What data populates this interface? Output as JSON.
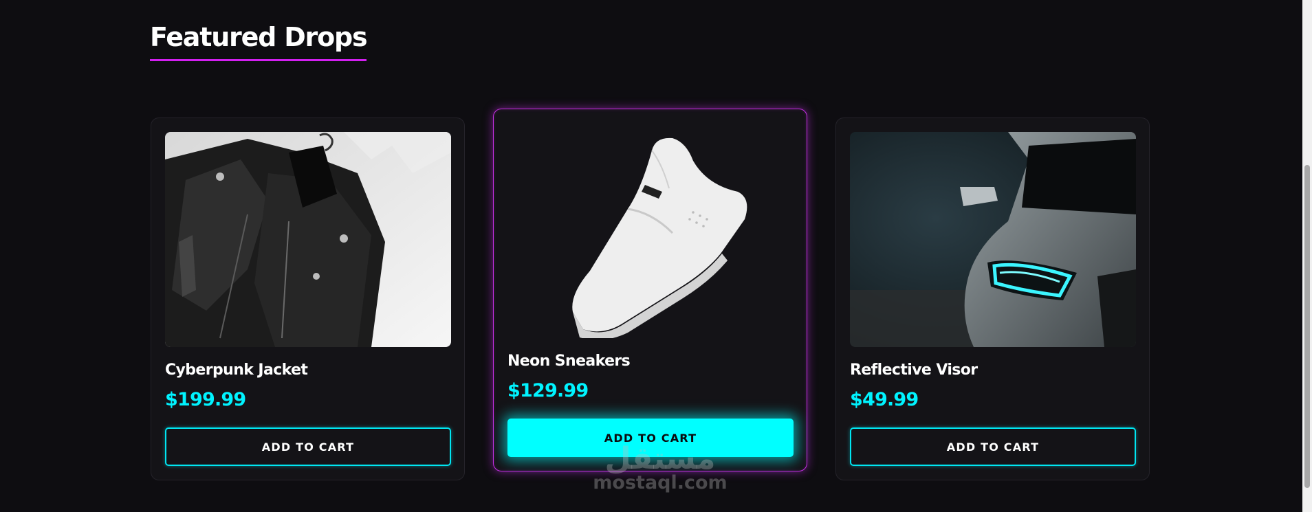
{
  "section": {
    "title": "Featured Drops"
  },
  "products": [
    {
      "name": "Cyberpunk Jacket",
      "price": "$199.99",
      "button": "ADD TO CART",
      "image": "black-leather-jacket-photo"
    },
    {
      "name": "Neon Sneakers",
      "price": "$129.99",
      "button": "ADD TO CART",
      "image": "white-sneaker-photo",
      "featured": true
    },
    {
      "name": "Reflective Visor",
      "price": "$49.99",
      "button": "ADD TO CART",
      "image": "car-headlight-photo"
    }
  ],
  "watermark": {
    "arabic": "مستقل",
    "latin": "mostaql.com"
  },
  "colors": {
    "background": "#0e0d11",
    "card": "#141317",
    "accent_cyan": "#00ffff",
    "accent_magenta": "#d21ff0"
  }
}
